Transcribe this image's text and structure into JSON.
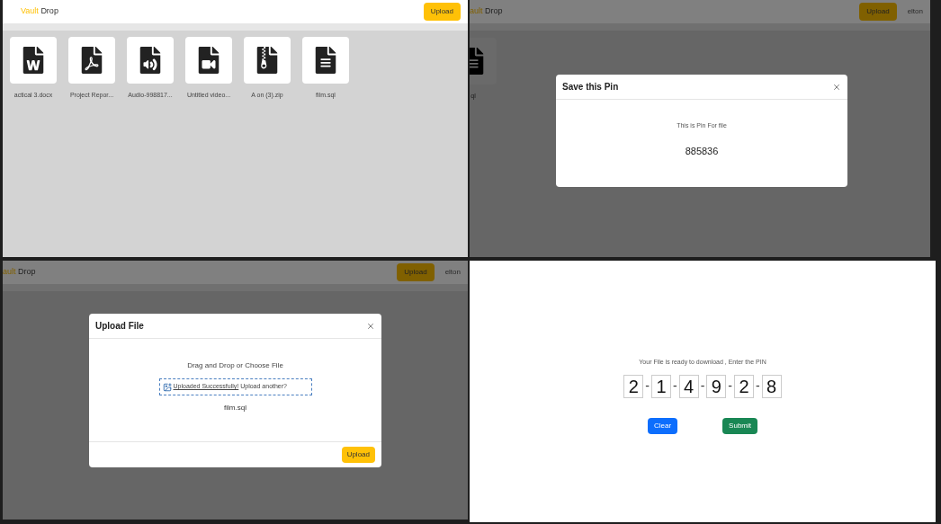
{
  "file_browser": {
    "header": {
      "brand_accent": "Vault",
      "brand_rest": "Drop",
      "upload_button": "Upload"
    },
    "files": [
      {
        "name": "actical 3.docx",
        "kind": "word"
      },
      {
        "name": "Project Repor...",
        "kind": "pdf"
      },
      {
        "name": "Audio-998817...",
        "kind": "audio"
      },
      {
        "name": "Untitled video...",
        "kind": "video"
      },
      {
        "name": "A on (3).zip",
        "kind": "zip"
      },
      {
        "name": "film.sql",
        "kind": "text"
      }
    ]
  },
  "pin_screen": {
    "header": {
      "brand_accent": "ault",
      "brand_rest": "Drop",
      "upload_button": "Upload",
      "user": "elton"
    },
    "files": [
      {
        "name": "ql",
        "kind": "text"
      }
    ],
    "dialog": {
      "title": "Save this Pin",
      "message": "This is Pin For file",
      "pin": "885836"
    }
  },
  "upload_screen": {
    "header": {
      "brand_accent": "ault",
      "brand_rest": "Drop",
      "upload_button": "Upload",
      "user": "elton"
    },
    "dialog": {
      "title": "Upload File",
      "prompt": "Drag and Drop or Choose File",
      "status_link": "Uploaded Successfully!",
      "status_rest": "Upload another?",
      "file_name": "film.sql",
      "upload_button": "Upload"
    }
  },
  "download_screen": {
    "message": "Your File is ready to download , Enter the PIN",
    "digits": [
      "2",
      "1",
      "4",
      "9",
      "2",
      "8"
    ],
    "separator": "-",
    "clear_button": "Clear",
    "submit_button": "Submit"
  }
}
